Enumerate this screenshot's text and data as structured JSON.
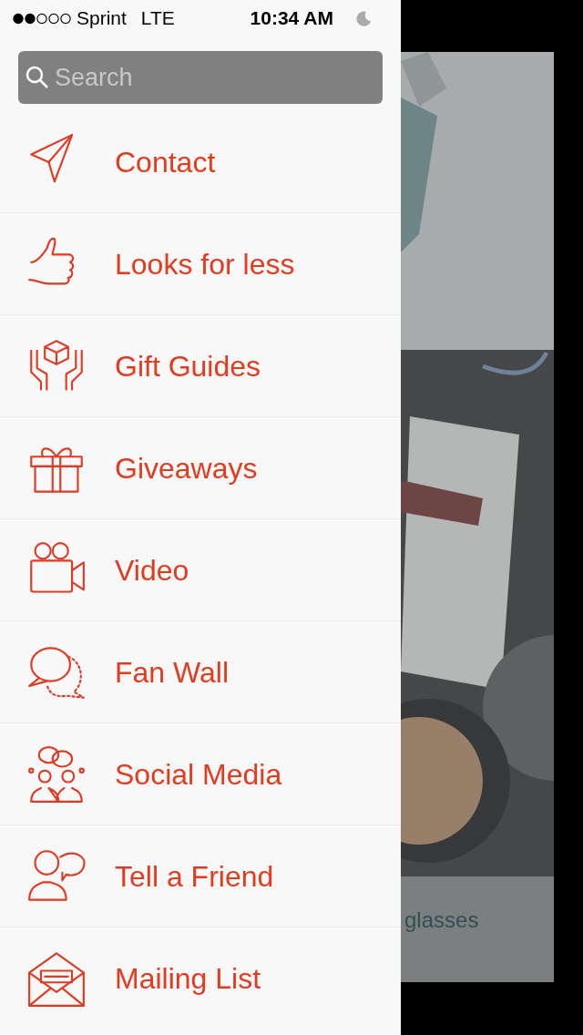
{
  "status_bar": {
    "carrier": "Sprint",
    "network": "LTE",
    "time": "10:34 AM"
  },
  "search": {
    "placeholder": "Search"
  },
  "menu": [
    {
      "label": "Contact",
      "kind": "send"
    },
    {
      "label": "Looks for less",
      "kind": "thumb"
    },
    {
      "label": "Gift Guides",
      "kind": "hands"
    },
    {
      "label": "Giveaways",
      "kind": "gift"
    },
    {
      "label": "Video",
      "kind": "video"
    },
    {
      "label": "Fan Wall",
      "kind": "chat"
    },
    {
      "label": "Social Media",
      "kind": "social"
    },
    {
      "label": "Tell a Friend",
      "kind": "friend"
    },
    {
      "label": "Mailing List",
      "kind": "mail"
    }
  ],
  "behind": {
    "caption": "glasses"
  }
}
